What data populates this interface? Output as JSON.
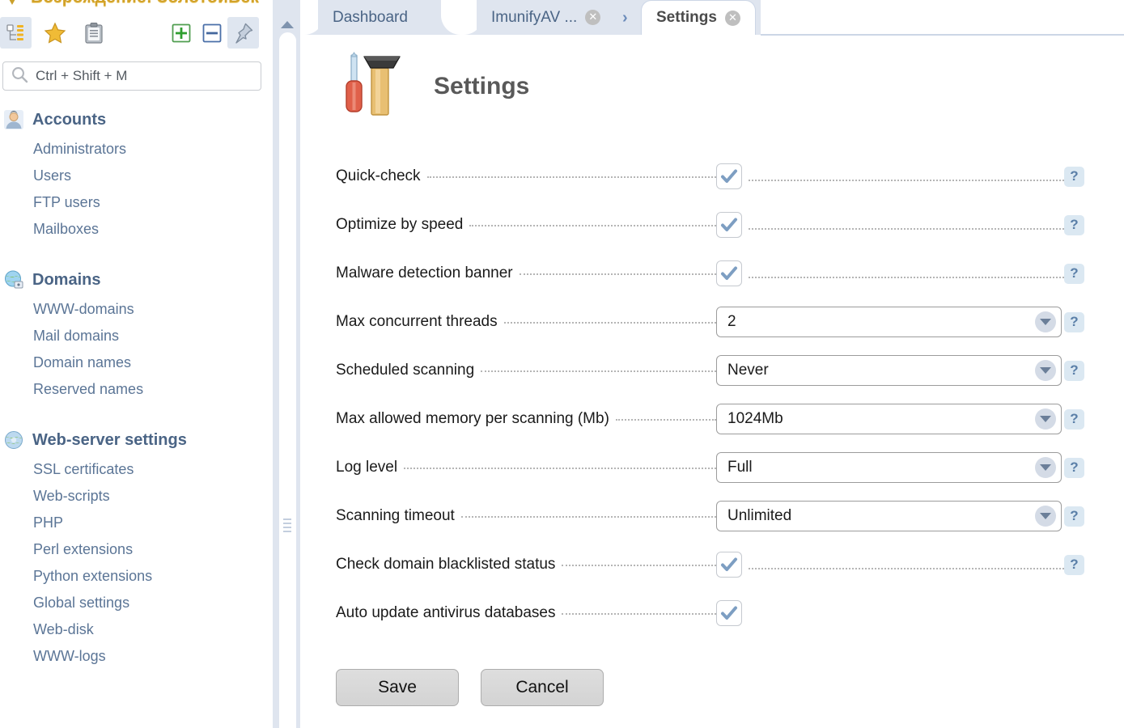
{
  "brand": {
    "text": "Возрождение: ЗолотойВек",
    "mark": "logo-mark"
  },
  "nav_toolbar": {
    "buttons": [
      {
        "name": "tree-view-icon",
        "label": "Tree view"
      },
      {
        "name": "favorites-star-icon",
        "label": "Favorites"
      },
      {
        "name": "clipboard-icon",
        "label": "Clipboard"
      },
      {
        "name": "expand-all-icon",
        "label": "Expand all"
      },
      {
        "name": "collapse-all-icon",
        "label": "Collapse all"
      },
      {
        "name": "pin-icon",
        "label": "Pin panel"
      }
    ]
  },
  "search": {
    "icon": "search-icon",
    "placeholder": "Ctrl + Shift + M",
    "value": ""
  },
  "sidebar": {
    "groups": [
      {
        "label": "Accounts",
        "icon": "user-icon",
        "items": [
          "Administrators",
          "Users",
          "FTP users",
          "Mailboxes"
        ]
      },
      {
        "label": "Domains",
        "icon": "globe-lock-icon",
        "items": [
          "WWW-domains",
          "Mail domains",
          "Domain names",
          "Reserved names"
        ]
      },
      {
        "label": "Web-server settings",
        "icon": "globe-gear-icon",
        "items": [
          "SSL certificates",
          "Web-scripts",
          "PHP",
          "Perl extensions",
          "Python extensions",
          "Global settings",
          "Web-disk",
          "WWW-logs"
        ]
      }
    ]
  },
  "scrollbar": {
    "up_arrow": "scroll-up-arrow-icon",
    "grip": "splitter-grip-icon"
  },
  "tabs": [
    {
      "label": "Dashboard",
      "active": false,
      "closable": false
    },
    {
      "label": "ImunifyAV ...",
      "active": false,
      "closable": true
    },
    {
      "label": "Settings",
      "active": true,
      "closable": true
    }
  ],
  "tab_separator": "›",
  "page": {
    "icon": "hammer-screwdriver-icon",
    "title": "Settings"
  },
  "form": {
    "rows": [
      {
        "label": "Quick-check",
        "type": "checkbox",
        "checked": true,
        "help": true
      },
      {
        "label": "Optimize by speed",
        "type": "checkbox",
        "checked": true,
        "help": true
      },
      {
        "label": "Malware detection banner",
        "type": "checkbox",
        "checked": true,
        "help": true
      },
      {
        "label": "Max concurrent threads",
        "type": "select",
        "value": "2",
        "help": true
      },
      {
        "label": "Scheduled scanning",
        "type": "select",
        "value": "Never",
        "help": true
      },
      {
        "label": "Max allowed memory per scanning (Mb)",
        "type": "select",
        "value": "1024Mb",
        "help": true
      },
      {
        "label": "Log level",
        "type": "select",
        "value": "Full",
        "help": true
      },
      {
        "label": "Scanning timeout",
        "type": "select",
        "value": "Unlimited",
        "help": true
      },
      {
        "label": "Check domain blacklisted status",
        "type": "checkbox",
        "checked": true,
        "help": true
      },
      {
        "label": "Auto update antivirus databases",
        "type": "checkbox",
        "checked": true,
        "help": false
      }
    ],
    "help_glyph": "?"
  },
  "actions": {
    "save_label": "Save",
    "cancel_label": "Cancel"
  },
  "colors": {
    "panel_bg": "#dfe5ef",
    "nav_link": "#5b7596",
    "nav_group": "#4a6485",
    "accent_blue": "#6b8fb5",
    "help_bg": "#dbe8f2",
    "brand_gold": "#d2a229"
  }
}
